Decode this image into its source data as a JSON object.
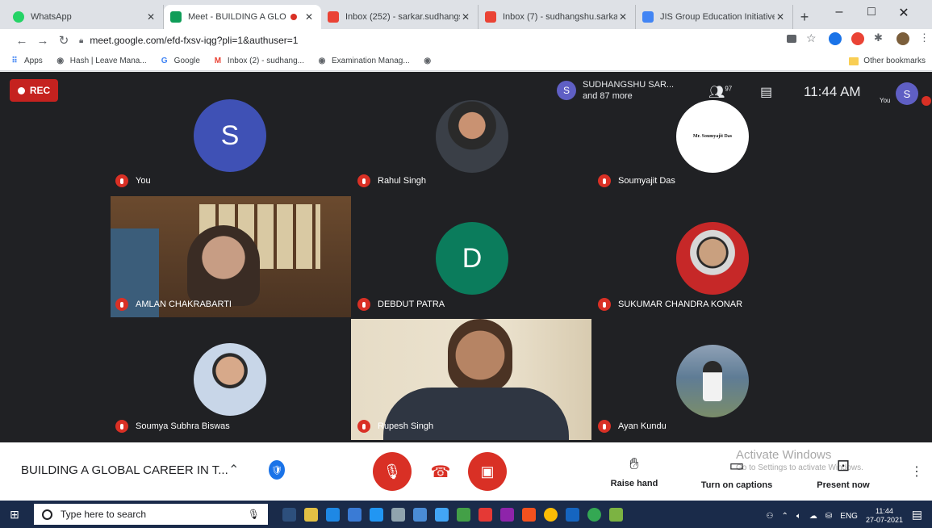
{
  "browser": {
    "tabs": [
      {
        "label": "WhatsApp",
        "fav_color": "#25d366",
        "active": false
      },
      {
        "label": "Meet - BUILDING A GLO",
        "fav_color": "#0f9d58",
        "active": true
      },
      {
        "label": "Inbox (252) - sarkar.sudhangs",
        "fav_color": "#ea4335",
        "active": false
      },
      {
        "label": "Inbox (7) - sudhangshu.sarkar",
        "fav_color": "#ea4335",
        "active": false
      },
      {
        "label": "JIS Group Education Initiative",
        "fav_color": "#4285f4",
        "active": false
      }
    ],
    "new_tab": "+",
    "window_controls": {
      "minimize": "–",
      "maximize": "□",
      "close": "✕"
    },
    "url": "meet.google.com/efd-fxsv-iqg?pli=1&authuser=1",
    "bookmarks": [
      {
        "label": "Apps",
        "icon": "apps-grid-icon",
        "color": "#4285f4"
      },
      {
        "label": "Hash | Leave Mana...",
        "icon": "globe-icon",
        "color": "#5f6368"
      },
      {
        "label": "Google",
        "icon": "google-g-icon",
        "color": "#4285f4"
      },
      {
        "label": "Inbox (2) - sudhang...",
        "icon": "gmail-icon",
        "color": "#ea4335"
      },
      {
        "label": "Examination Manag...",
        "icon": "globe-icon",
        "color": "#5f6368"
      },
      {
        "label": "",
        "icon": "globe-icon",
        "color": "#5f6368"
      }
    ],
    "other_bookmarks": "Other bookmarks"
  },
  "meet": {
    "rec_label": "REC",
    "presenter": {
      "initial": "S",
      "name": "SUDHANGSHU SAR...",
      "more": "and 87 more"
    },
    "people_count": "97",
    "time": "11:44 AM",
    "you_initial": "S",
    "you_label": "You",
    "participants": [
      {
        "name": "You",
        "initial": "S",
        "color": "#3f51b5",
        "type": "letter"
      },
      {
        "name": "Rahul Singh",
        "type": "photo"
      },
      {
        "name": "Soumyajit Das",
        "type": "logo",
        "logo_text": "Mr. Soumyajit Das"
      },
      {
        "name": "AMLAN CHAKRABARTI",
        "type": "video"
      },
      {
        "name": "DEBDUT PATRA",
        "initial": "D",
        "color": "#0b7c5c",
        "type": "letter"
      },
      {
        "name": "SUKUMAR CHANDRA KONAR",
        "type": "photo"
      },
      {
        "name": "Soumya Subhra Biswas",
        "type": "photo"
      },
      {
        "name": "Rupesh Singh",
        "type": "video"
      },
      {
        "name": "Ayan Kundu",
        "type": "photo"
      }
    ],
    "meeting_title": "BUILDING A GLOBAL CAREER IN T...",
    "actions": {
      "raise_hand": "Raise hand",
      "captions": "Turn on captions",
      "present": "Present now"
    },
    "watermark": {
      "title": "Activate Windows",
      "subtitle": "Go to Settings to activate Windows."
    }
  },
  "taskbar": {
    "search_placeholder": "Type here to search",
    "language": "ENG",
    "clock_time": "11:44",
    "clock_date": "27-07-2021"
  }
}
